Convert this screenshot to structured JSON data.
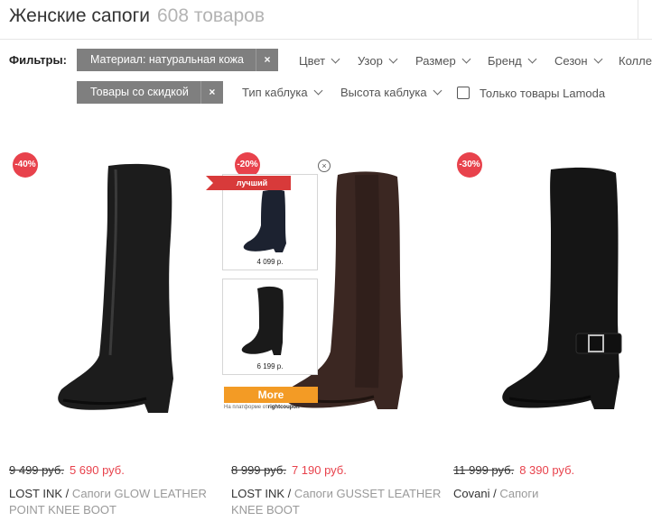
{
  "header": {
    "title": "Женские сапоги",
    "count": "608 товаров"
  },
  "filters": {
    "label": "Фильтры:",
    "active_chips": [
      {
        "label": "Материал: натуральная кожа",
        "remove": "×"
      },
      {
        "label": "Товары со скидкой",
        "remove": "×"
      }
    ],
    "dropdowns_row1": [
      "Цвет",
      "Узор",
      "Размер",
      "Бренд",
      "Сезон",
      "Колле"
    ],
    "dropdowns_row2": [
      "Тип каблука",
      "Высота каблука"
    ],
    "checkbox_label": "Только товары Lamoda",
    "checkbox_checked": false
  },
  "products": [
    {
      "discount": "-40%",
      "old_price": "9 499 руб.",
      "new_price": "5 690 руб.",
      "brand": "LOST INK",
      "category": "Сапоги GLOW LEATHER POINT KNEE BOOT",
      "boot_color": "#1c1c1c"
    },
    {
      "discount": "-20%",
      "old_price": "8 999 руб.",
      "new_price": "7 190 руб.",
      "brand": "LOST INK",
      "category": "Сапоги GUSSET LEATHER KNEE BOOT",
      "boot_color": "#3b2722"
    },
    {
      "discount": "-30%",
      "old_price": "11 999 руб.",
      "new_price": "8 390 руб.",
      "brand": "Covani",
      "category": "Сапоги",
      "boot_color": "#151515"
    }
  ],
  "popup": {
    "ribbon": "лучший",
    "items": [
      {
        "price": "4 099 р."
      },
      {
        "price": "6 199 р."
      }
    ],
    "more_label": "More",
    "platform_text": "На платформе от",
    "platform_brand": "rightcoupon",
    "close_icon": "close-circle-icon"
  },
  "colors": {
    "accent_red": "#e8424c",
    "chip_gray": "#7f7f7f",
    "more_orange": "#f39b25"
  }
}
